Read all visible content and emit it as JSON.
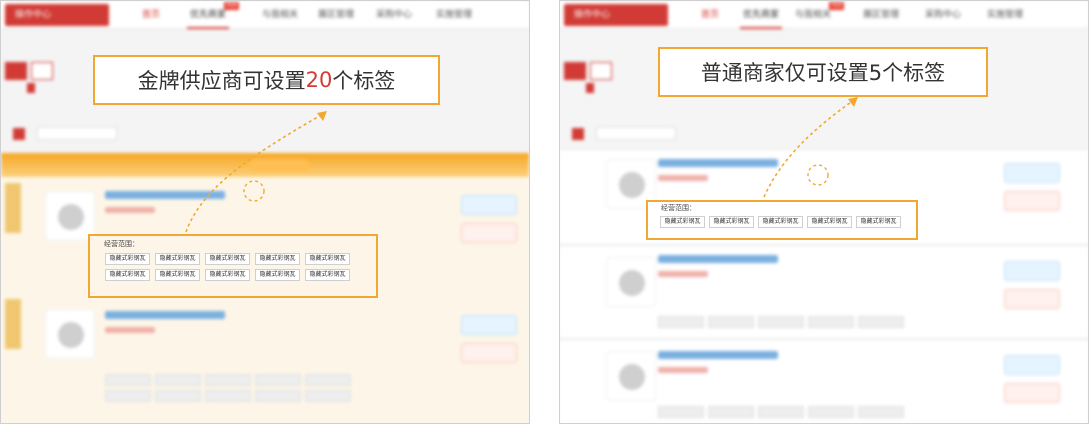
{
  "panels": [
    {
      "brand": "操作中心",
      "nav": [
        "首页",
        "优先商家",
        "与我相关",
        "展区管理",
        "采购中心",
        "实施管理"
      ],
      "hot_badge": "Hot",
      "callout": {
        "prefix": "金牌供应商可设置",
        "highlight": "20",
        "suffix": "个标签"
      },
      "scope_label": "经营范围：",
      "tag_text": "隐藏式彩钢瓦",
      "tag_count": 10
    },
    {
      "brand": "操作中心",
      "nav": [
        "首页",
        "优先商家",
        "与我相关",
        "展区管理",
        "采购中心",
        "实施管理"
      ],
      "hot_badge": "Hot",
      "callout": {
        "prefix": "普通商家仅可设置5个标签",
        "highlight": "",
        "suffix": ""
      },
      "scope_label": "经营范围：",
      "tag_text": "隐藏式彩钢瓦",
      "tag_count": 5
    }
  ],
  "colors": {
    "accent": "#d23b35",
    "callout_border": "#f0a830",
    "gold": "#f6a623"
  }
}
